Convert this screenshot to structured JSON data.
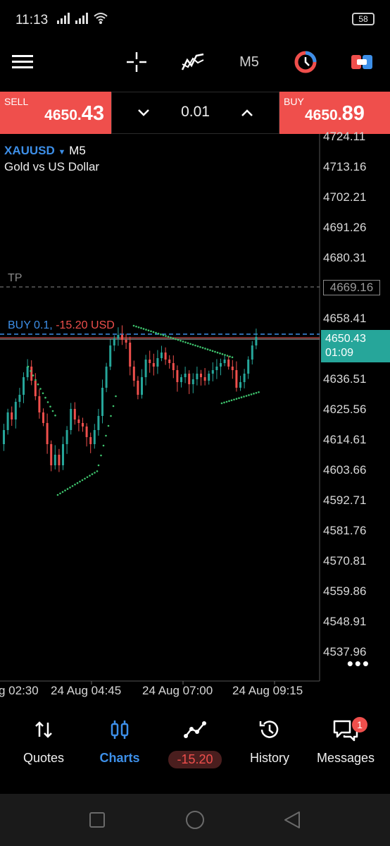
{
  "status": {
    "time": "11:13",
    "battery": "58"
  },
  "toolbar": {
    "timeframe": "M5"
  },
  "trade": {
    "sell_label": "SELL",
    "sell_big": "4650.",
    "sell_frac": "43",
    "buy_label": "BUY",
    "buy_big": "4650.",
    "buy_frac": "89",
    "lot": "0.01"
  },
  "chart": {
    "symbol": "XAUUSD",
    "timeframe": "M5",
    "description": "Gold vs US Dollar",
    "price_labels": [
      "4724.11",
      "4713.16",
      "4702.21",
      "4691.26",
      "4680.31",
      "4658.41",
      "4636.51",
      "4625.56",
      "4614.61",
      "4603.66",
      "4592.71",
      "4581.76",
      "4570.81",
      "4559.86",
      "4548.91",
      "4537.96"
    ],
    "tp_label": "TP",
    "tp_price": "4669.16",
    "position_label": "BUY 0.1,",
    "position_pl": "-15.20 USD",
    "current_price": "4650.43",
    "countdown": "01:09",
    "time_labels": [
      "g 02:30",
      "24 Aug 04:45",
      "24 Aug 07:00",
      "24 Aug 09:15"
    ],
    "colors": {
      "bull": "#26a69a",
      "bear": "#ef4f4c",
      "sar": "#3ec46d",
      "accent": "#3d8fe8"
    }
  },
  "nav": {
    "quotes": "Quotes",
    "charts": "Charts",
    "trade_pl": "-15.20",
    "history": "History",
    "messages": "Messages",
    "messages_badge": "1"
  }
}
